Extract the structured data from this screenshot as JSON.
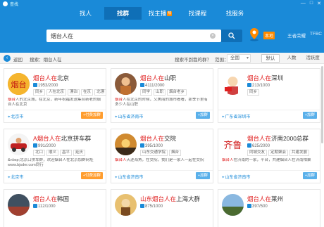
{
  "app": {
    "title": "查找",
    "user": "王者荣耀",
    "user_code": "TFBC"
  },
  "nav": {
    "tabs": [
      {
        "label": "找人",
        "active": false
      },
      {
        "label": "找群",
        "active": true
      },
      {
        "label": "找主播",
        "active": false,
        "badge": "热"
      },
      {
        "label": "找课程",
        "active": false
      },
      {
        "label": "找服务",
        "active": false
      }
    ]
  },
  "search": {
    "value": "烟台人在",
    "local_tag": "本地"
  },
  "filter": {
    "back": "返回",
    "search_label": "搜索：烟台人在",
    "not_found": "搜索不到我的群？",
    "range_label": "范围：",
    "range_value": "全国",
    "sort": [
      "默认",
      "人数",
      "活跃度"
    ],
    "sort_selected": "默认"
  },
  "colors": {
    "primary": "#1a8ad8",
    "highlight": "#e02020",
    "accent": "#ff8a00"
  },
  "cards": [
    {
      "name_hl": "烟台人在",
      "name_rest": "北京",
      "id": "1953/2000",
      "tags": [
        "同乡",
        "人在北京",
        "漂泊",
        "在京",
        "北漂"
      ],
      "desc_hl": "烟台",
      "desc": "人的北京城，在北京，新年祝福发送集合新老的烟台人在北京",
      "city": "北京市",
      "button": "+付费加群",
      "button_type": "orange"
    },
    {
      "name_hl": "烟台人在",
      "name_rest": "山职",
      "id": "4111/2000",
      "tags": [
        "同学",
        "山职",
        "烟台老乡"
      ],
      "desc_hl": "烟台",
      "desc": "人在北京的时候，又美丽的城市看看，那季节里有多少人在山职",
      "city": "山东省济南市",
      "button": "+加群",
      "button_type": "blue"
    },
    {
      "name_hl": "烟台人在",
      "name_rest": "深圳",
      "id": "213/1000",
      "tags": [
        "同乡"
      ],
      "desc_hl": "",
      "desc": "",
      "city": "广东省深圳市",
      "button": "+加群",
      "button_type": "blue"
    },
    {
      "name_hl": "A烟台人在",
      "name_rest": "北京拼车群",
      "id": "991/2000",
      "tags": [
        "北口",
        "顺义",
        "昌平",
        "延庆"
      ],
      "desc_hl": "",
      "desc": "&nbsp;北京口拼车群，欢迎烟台人在北京加群网址 www.bjsder.com同行",
      "city": "北京市",
      "button": "+付费加群",
      "button_type": "orange"
    },
    {
      "name_hl": "烟台人在",
      "name_rest": "交院",
      "id": "395/1000",
      "tags": [
        "山东交通学院",
        "烟台"
      ],
      "desc_hl": "烟台人",
      "desc": "天涯海角，在交院，我们是一家人一起在交院",
      "city": "山东省济南市",
      "button": "+加群",
      "button_type": "blue"
    },
    {
      "name_hl": "烟台人在",
      "name_rest": "济南2000总群",
      "id": "625/2000",
      "tags": [
        "同城交友",
        "定期聚会",
        "共建发展"
      ],
      "desc_hl": "烟台人",
      "desc": "在济南的一家，平台，共建烟台人在济南相聚",
      "city": "山东省济南市",
      "button": "+加群",
      "button_type": "blue"
    },
    {
      "name_hl": "烟台人在",
      "name_rest": "韩国",
      "id": "112/1000",
      "tags": [],
      "desc_hl": "",
      "desc": "",
      "city": "",
      "button": "",
      "button_type": "blue"
    },
    {
      "name_hl": "山东烟台人在",
      "name_rest": "上海大群",
      "id": "875/1000",
      "tags": [],
      "desc_hl": "",
      "desc": "",
      "city": "",
      "button": "",
      "button_type": "blue"
    },
    {
      "name_hl": "烟台人在",
      "name_rest": "莱州",
      "id": "397/500",
      "tags": [],
      "desc_hl": "",
      "desc": "",
      "city": "",
      "button": "",
      "button_type": "blue"
    }
  ]
}
